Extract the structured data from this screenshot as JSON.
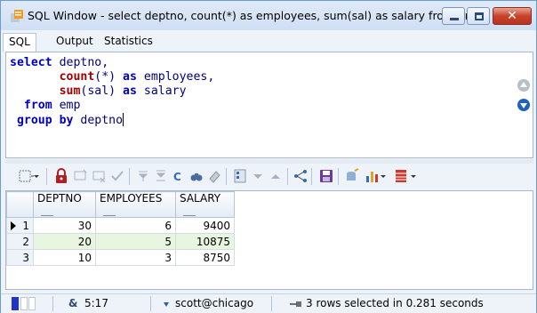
{
  "window": {
    "title": "SQL Window - select deptno, count(*) as employees, sum(sal) as salary from em...",
    "close_glyph": "✕"
  },
  "tabs": [
    {
      "label": "SQL",
      "active": true
    },
    {
      "label": "Output",
      "active": false
    },
    {
      "label": "Statistics",
      "active": false
    }
  ],
  "editor": {
    "lines": [
      [
        {
          "t": "select",
          "c": "kw"
        },
        {
          "t": " deptno,",
          "c": "id"
        }
      ],
      [
        {
          "t": "       ",
          "c": "id"
        },
        {
          "t": "count",
          "c": "kw2"
        },
        {
          "t": "(*) ",
          "c": "id"
        },
        {
          "t": "as",
          "c": "kw"
        },
        {
          "t": " employees,",
          "c": "id"
        }
      ],
      [
        {
          "t": "       ",
          "c": "id"
        },
        {
          "t": "sum",
          "c": "kw2"
        },
        {
          "t": "(sal) ",
          "c": "id"
        },
        {
          "t": "as",
          "c": "kw"
        },
        {
          "t": " salary",
          "c": "id"
        }
      ],
      [
        {
          "t": "  ",
          "c": "id"
        },
        {
          "t": "from",
          "c": "kw"
        },
        {
          "t": " emp",
          "c": "id"
        }
      ],
      [
        {
          "t": " ",
          "c": "id"
        },
        {
          "t": "group by",
          "c": "kw"
        },
        {
          "t": " deptno",
          "c": "id"
        }
      ]
    ]
  },
  "toolbar": {
    "icons": [
      "grid-menu-icon",
      "lock-icon",
      "insert-record-icon",
      "delete-record-icon",
      "post-icon",
      "filter-icon",
      "clear-filter-icon",
      "refresh-icon",
      "find-icon",
      "clear-icon",
      "single-record-icon",
      "next-icon",
      "previous-icon",
      "query-by-example-icon",
      "save-icon",
      "export-icon",
      "chart-icon",
      "layout-icon"
    ]
  },
  "grid": {
    "columns": [
      "DEPTNO",
      "EMPLOYEES",
      "SALARY"
    ],
    "rows": [
      {
        "n": "1",
        "cells": [
          "30",
          "6",
          "9400"
        ],
        "current": true,
        "selected": false
      },
      {
        "n": "2",
        "cells": [
          "20",
          "5",
          "10875"
        ],
        "current": false,
        "selected": true
      },
      {
        "n": "3",
        "cells": [
          "10",
          "3",
          "8750"
        ],
        "current": false,
        "selected": false
      }
    ]
  },
  "statusbar": {
    "ampersand": "&",
    "cursor": "5:17",
    "connection": "scott@chicago",
    "rows_info": "3 rows selected in 0.281 seconds"
  },
  "colors": {
    "accent": "#1e63b8",
    "keyword": "#0000c0",
    "function": "#a00000",
    "selected_row": "#e8f6e0"
  }
}
